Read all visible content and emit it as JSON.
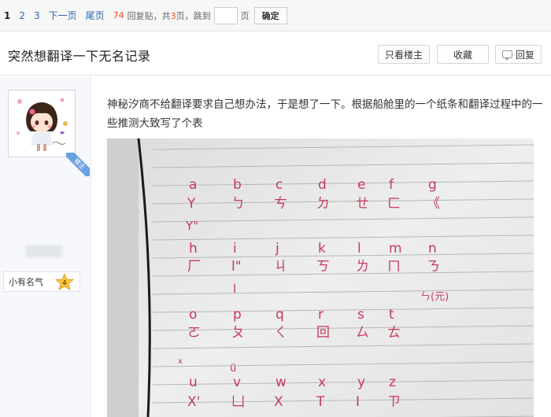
{
  "pager": {
    "current": "1",
    "pages": [
      "2",
      "3"
    ],
    "next": "下一页",
    "last": "尾页",
    "reply_count": "74",
    "reply_text": "回复贴，共",
    "total_pages": "3",
    "pages_suffix": "页，跳到",
    "page_unit": "页",
    "confirm": "确定"
  },
  "thread": {
    "title": "突然想翻译一下无名记录",
    "only_op": "只看楼主",
    "favorite": "收藏",
    "reply": "回复"
  },
  "author": {
    "op_badge": "楼主",
    "level_name": "小有名气",
    "level": "4"
  },
  "post": {
    "text": "神秘汐商不给翻译要求自己想办法，于是想了一下。根据船舱里的一个纸条和翻译过程中的一些推测大致写了个表"
  },
  "notebook": {
    "rows": [
      [
        [
          "a",
          "Y"
        ],
        [
          "b",
          "ㄅ"
        ],
        [
          "c",
          "ㄘ"
        ],
        [
          "d",
          "ㄉ"
        ],
        [
          "e",
          "ㄝ"
        ],
        [
          "f",
          "ㄈ"
        ],
        [
          "g",
          "《"
        ]
      ],
      [
        [
          "h",
          "厂"
        ],
        [
          "i",
          "l\""
        ],
        [
          "j",
          "ㄐ"
        ],
        [
          "k",
          "ㄎ"
        ],
        [
          "l",
          "ㄌ"
        ],
        [
          "m",
          "ㄇ"
        ],
        [
          "n",
          "ㄋ"
        ]
      ],
      [
        [
          "o",
          "ㄛ"
        ],
        [
          "p",
          "ㄆ"
        ],
        [
          "q",
          "ㄑ"
        ],
        [
          "r",
          "回"
        ],
        [
          "s",
          "ㄙ"
        ],
        [
          "t",
          "ㄊ"
        ]
      ],
      [
        [
          "u",
          "X'"
        ],
        [
          "v",
          "凵"
        ],
        [
          "w",
          "X"
        ],
        [
          "x",
          "T"
        ],
        [
          "y",
          "I"
        ],
        [
          "z",
          "ㄗ"
        ]
      ]
    ],
    "extras": [
      "Y\"",
      "l",
      "ㄣ(元)",
      "ü",
      "x"
    ]
  },
  "colors": {
    "link": "#2d64b3",
    "accent_red": "#f7461e",
    "ink": "#c43a5c",
    "badge_blue": "#6aa0e0"
  }
}
